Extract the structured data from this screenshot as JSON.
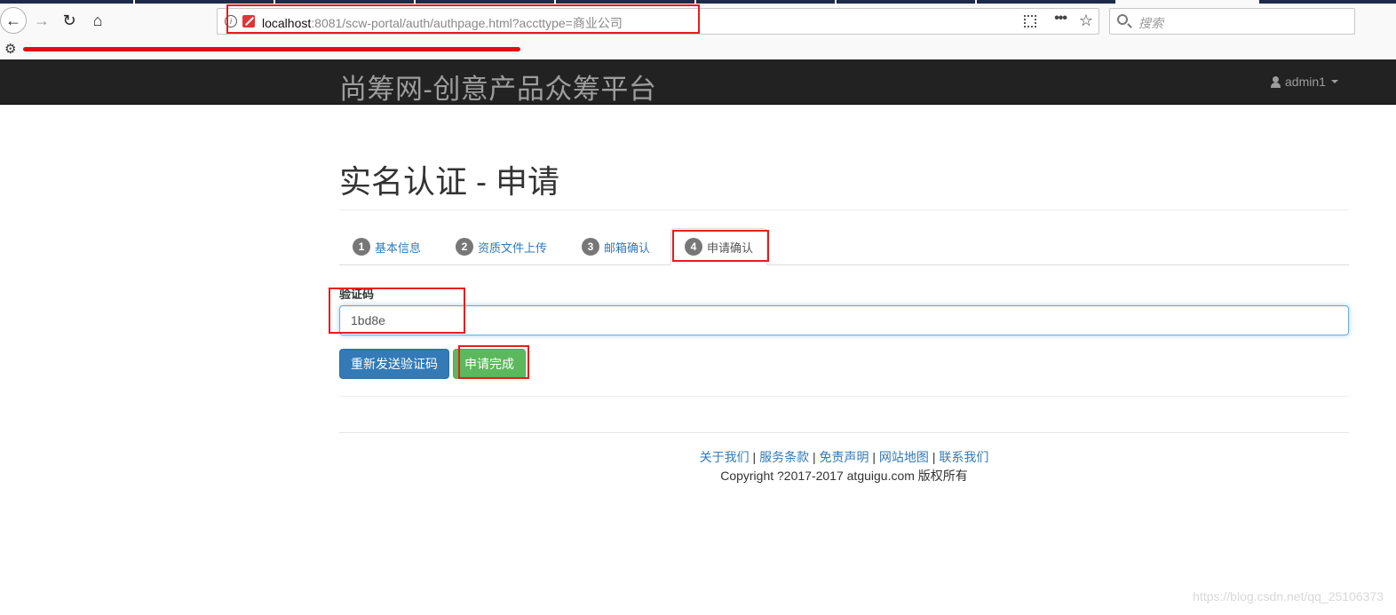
{
  "browser": {
    "url_host": "localhost",
    "url_rest": ":8081/scw-portal/auth/authpage.html?accttype=商业公司",
    "search_placeholder": "搜索"
  },
  "navbar": {
    "brand": "尚筹网-创意产品众筹平台",
    "user": "admin1"
  },
  "page": {
    "title": "实名认证 - 申请"
  },
  "tabs": [
    {
      "num": "1",
      "label": "基本信息"
    },
    {
      "num": "2",
      "label": "资质文件上传"
    },
    {
      "num": "3",
      "label": "邮箱确认"
    },
    {
      "num": "4",
      "label": "申请确认"
    }
  ],
  "form": {
    "code_label": "验证码",
    "code_value": "1bd8e"
  },
  "buttons": {
    "resend": "重新发送验证码",
    "complete": "申请完成"
  },
  "footer": {
    "links": [
      "关于我们",
      "服务条款",
      "免责声明",
      "网站地图",
      "联系我们"
    ],
    "separator": "|",
    "copyright": "Copyright ?2017-2017 atguigu.com 版权所有"
  },
  "watermark": "https://blog.csdn.net/qq_25106373",
  "colors": {
    "primary": "#337ab7",
    "success": "#5cb85c",
    "navbar": "#222222",
    "annotation": "#e81c1c"
  }
}
